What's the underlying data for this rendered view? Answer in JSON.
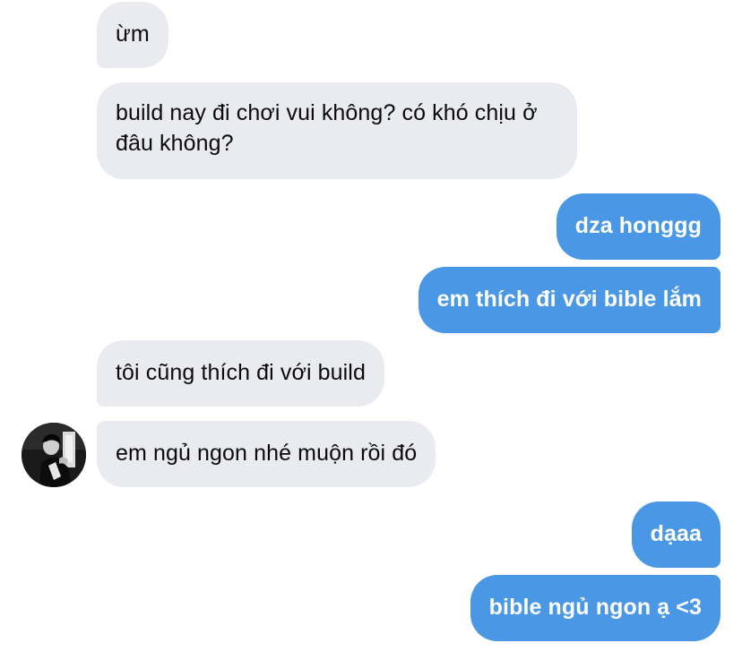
{
  "messages": [
    {
      "from": "them",
      "text": "ừm"
    },
    {
      "from": "them",
      "text": "build nay đi chơi vui không? có khó chịu ở đâu không?"
    },
    {
      "from": "me",
      "text": "dza honggg"
    },
    {
      "from": "me",
      "text": "em thích đi với bible lắm"
    },
    {
      "from": "them",
      "text": "tôi cũng thích đi với build"
    },
    {
      "from": "them",
      "text": "em ngủ ngon nhé muộn rồi đó"
    },
    {
      "from": "me",
      "text": "dạaa"
    },
    {
      "from": "me",
      "text": "bible ngủ ngon ạ <3"
    }
  ],
  "colors": {
    "incoming_bubble": "#e9ebf0",
    "outgoing_bubble": "#4a97e5",
    "incoming_text": "#0b0b0b",
    "outgoing_text": "#ffffff"
  },
  "avatar": {
    "icon": "contact-avatar-photo"
  }
}
